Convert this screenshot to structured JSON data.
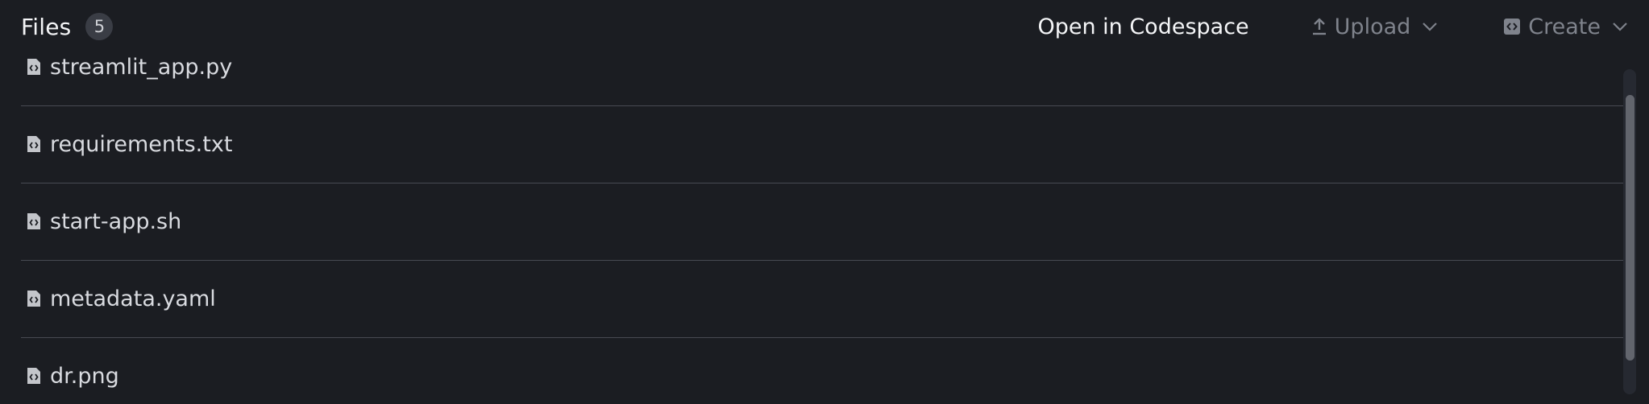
{
  "header": {
    "title": "Files",
    "count": "5",
    "open_in_codespace": "Open in Codespace",
    "upload_label": "Upload",
    "create_label": "Create"
  },
  "files": [
    {
      "name": "streamlit_app.py",
      "icon": "code-file-icon"
    },
    {
      "name": "requirements.txt",
      "icon": "code-file-icon"
    },
    {
      "name": "start-app.sh",
      "icon": "code-file-icon"
    },
    {
      "name": "metadata.yaml",
      "icon": "code-file-icon"
    },
    {
      "name": "dr.png",
      "icon": "code-file-icon"
    }
  ],
  "colors": {
    "background": "#1b1d22",
    "divider": "#474a52",
    "muted_action": "#7f838c",
    "primary_text": "#f4f5f7"
  }
}
